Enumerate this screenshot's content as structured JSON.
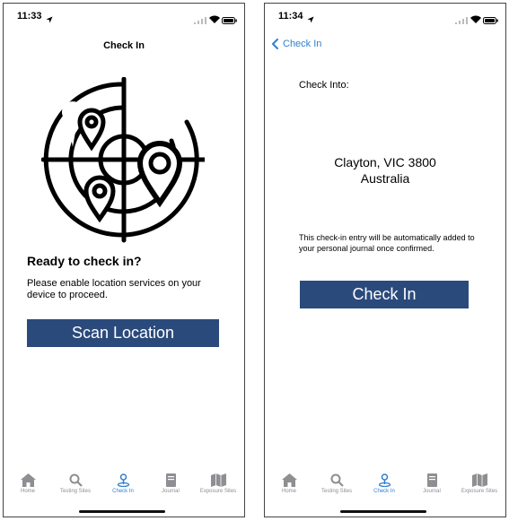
{
  "screen1": {
    "status_time": "11:33",
    "nav_title": "Check In",
    "heading": "Ready to check in?",
    "subtext": "Please enable location services on your device to proceed.",
    "scan_button": "Scan Location"
  },
  "screen2": {
    "status_time": "11:34",
    "back_label": "Check In",
    "check_into_label": "Check Into:",
    "address_line1": "Clayton, VIC 3800",
    "address_line2": "Australia",
    "notice": "This check-in entry will be automatically added to your personal journal once confirmed.",
    "checkin_button": "Check In"
  },
  "tabs": [
    {
      "label": "Home",
      "icon": "home-icon"
    },
    {
      "label": "Testing Sites",
      "icon": "search-icon"
    },
    {
      "label": "Check In",
      "icon": "pin-icon",
      "active": true
    },
    {
      "label": "Journal",
      "icon": "book-icon"
    },
    {
      "label": "Exposure Sites",
      "icon": "map-icon"
    }
  ],
  "colors": {
    "primary_button": "#2b4a7c",
    "accent_blue": "#2f7fd1",
    "tab_inactive": "#8e8e93"
  }
}
